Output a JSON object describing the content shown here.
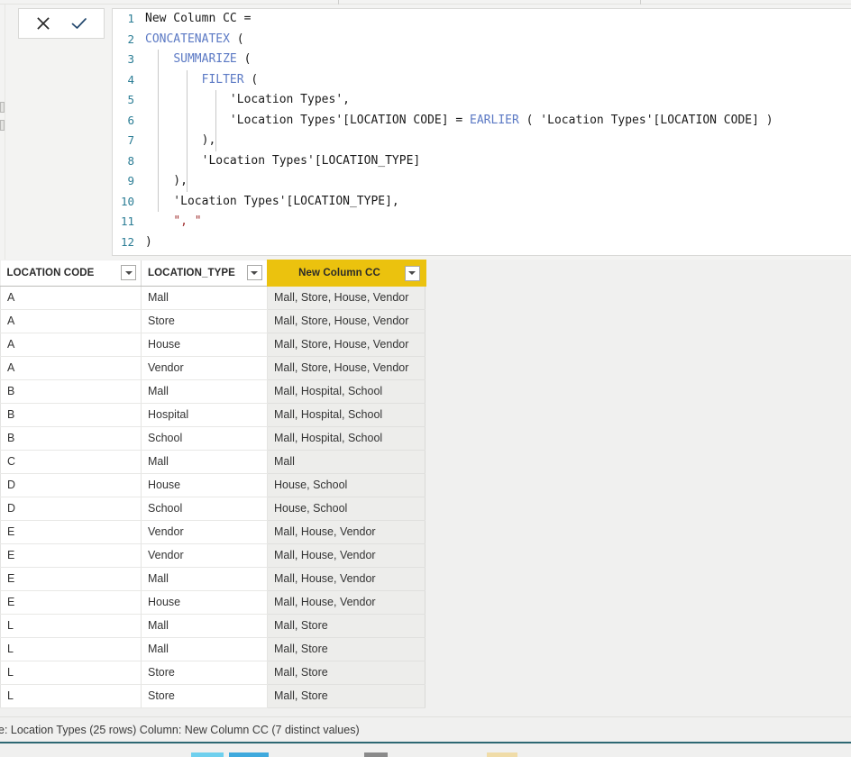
{
  "formula_bar": {
    "cancel_label": "✕",
    "accept_label": "✓",
    "cancel_name": "Cancel",
    "accept_name": "Commit",
    "lines": [
      {
        "num": "1",
        "segments": [
          {
            "t": "New Column CC =",
            "c": "op"
          }
        ]
      },
      {
        "num": "2",
        "segments": [
          {
            "t": "CONCATENATEX",
            "c": "fn"
          },
          {
            "t": " (",
            "c": "op"
          }
        ]
      },
      {
        "num": "3",
        "segments": [
          {
            "t": "    ",
            "c": "op"
          },
          {
            "t": "SUMMARIZE",
            "c": "fn"
          },
          {
            "t": " (",
            "c": "op"
          }
        ]
      },
      {
        "num": "4",
        "segments": [
          {
            "t": "        ",
            "c": "op"
          },
          {
            "t": "FILTER",
            "c": "fn"
          },
          {
            "t": " (",
            "c": "op"
          }
        ]
      },
      {
        "num": "5",
        "segments": [
          {
            "t": "            'Location Types',",
            "c": "op"
          }
        ]
      },
      {
        "num": "6",
        "segments": [
          {
            "t": "            'Location Types'[LOCATION CODE] = ",
            "c": "op"
          },
          {
            "t": "EARLIER",
            "c": "fn"
          },
          {
            "t": " ( 'Location Types'[LOCATION CODE] )",
            "c": "op"
          }
        ]
      },
      {
        "num": "7",
        "segments": [
          {
            "t": "        ),",
            "c": "op"
          }
        ]
      },
      {
        "num": "8",
        "segments": [
          {
            "t": "        'Location Types'[LOCATION_TYPE]",
            "c": "op"
          }
        ]
      },
      {
        "num": "9",
        "segments": [
          {
            "t": "    ),",
            "c": "op"
          }
        ]
      },
      {
        "num": "10",
        "segments": [
          {
            "t": "    'Location Types'[LOCATION_TYPE],",
            "c": "op"
          }
        ]
      },
      {
        "num": "11",
        "segments": [
          {
            "t": "    ",
            "c": "op"
          },
          {
            "t": "\", \"",
            "c": "str"
          }
        ]
      },
      {
        "num": "12",
        "segments": [
          {
            "t": ")",
            "c": "op"
          }
        ]
      }
    ]
  },
  "table": {
    "columns": [
      {
        "label": "LOCATION CODE",
        "selected": false
      },
      {
        "label": "LOCATION_TYPE",
        "selected": false
      },
      {
        "label": "New Column CC",
        "selected": true
      }
    ],
    "rows": [
      [
        "A",
        "Mall",
        "Mall, Store, House, Vendor"
      ],
      [
        "A",
        "Store",
        "Mall, Store, House, Vendor"
      ],
      [
        "A",
        "House",
        "Mall, Store, House, Vendor"
      ],
      [
        "A",
        "Vendor",
        "Mall, Store, House, Vendor"
      ],
      [
        "B",
        "Mall",
        "Mall, Hospital, School"
      ],
      [
        "B",
        "Hospital",
        "Mall, Hospital, School"
      ],
      [
        "B",
        "School",
        "Mall, Hospital, School"
      ],
      [
        "C",
        "Mall",
        "Mall"
      ],
      [
        "D",
        "House",
        "House, School"
      ],
      [
        "D",
        "School",
        "House, School"
      ],
      [
        "E",
        "Vendor",
        "Mall, House, Vendor"
      ],
      [
        "E",
        "Vendor",
        "Mall, House, Vendor"
      ],
      [
        "E",
        "Mall",
        "Mall, House, Vendor"
      ],
      [
        "E",
        "House",
        "Mall, House, Vendor"
      ],
      [
        "L",
        "Mall",
        "Mall, Store"
      ],
      [
        "L",
        "Mall",
        "Mall, Store"
      ],
      [
        "L",
        "Store",
        "Mall, Store"
      ],
      [
        "L",
        "Store",
        "Mall, Store"
      ]
    ]
  },
  "status": {
    "text": "e: Location Types (25 rows) Column: New Column CC (7 distinct values)"
  },
  "colors": {
    "selected_header": "#ebc20e",
    "selected_column_bg": "#ededeb",
    "line_number": "#2b7d95",
    "function_keyword": "#5b79c4",
    "string_literal": "#a03030",
    "teal_rule": "#2e6873"
  }
}
